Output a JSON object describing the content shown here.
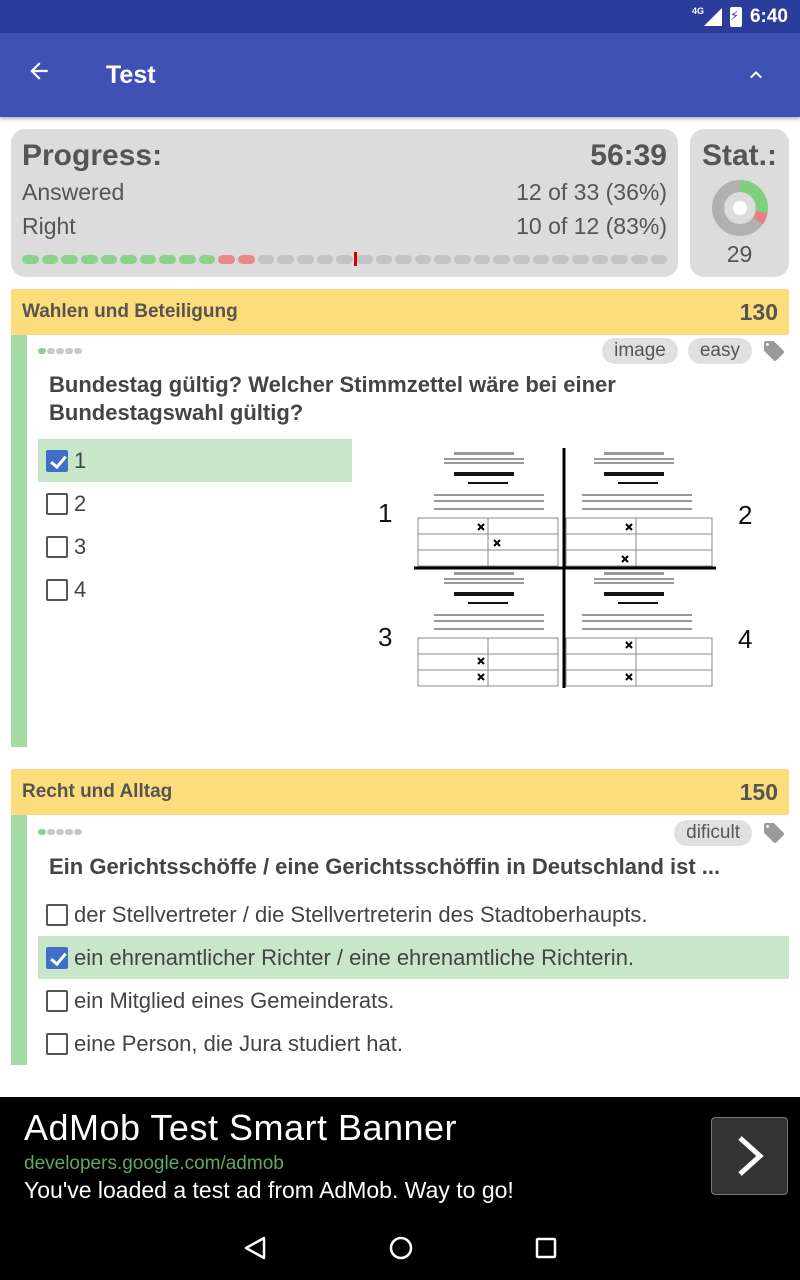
{
  "status_bar": {
    "network": "4G",
    "time": "6:40"
  },
  "app_bar": {
    "title": "Test"
  },
  "progress": {
    "heading": "Progress:",
    "timer": "56:39",
    "answered_label": "Answered",
    "answered_value": "12 of 33 (36%)",
    "right_label": "Right",
    "right_value": "10 of 12 (83%)"
  },
  "stats": {
    "heading": "Stat.:",
    "value": "29"
  },
  "questions": [
    {
      "topic": "Wahlen und Beteiligung",
      "number": "130",
      "tags": [
        "image",
        "easy"
      ],
      "text": "Bundestag gültig? Welcher Stimmzettel wäre bei einer Bundestagswahl gültig?",
      "options": [
        "1",
        "2",
        "3",
        "4"
      ],
      "selected_index": 0,
      "image_labels": [
        "1",
        "2",
        "3",
        "4"
      ]
    },
    {
      "topic": "Recht und Alltag",
      "number": "150",
      "tags": [
        "dificult"
      ],
      "text": "Ein Gerichtsschöffe / eine Gerichtsschöffin in Deutschland ist ...",
      "options": [
        "der Stellvertreter / die Stellvertreterin des Stadtoberhaupts.",
        "ein ehrenamtlicher Richter / eine ehrenamtliche Richterin.",
        "ein Mitglied eines Gemeinderats.",
        "eine Person, die Jura studiert hat."
      ],
      "selected_index": 1
    }
  ],
  "ad": {
    "title": "AdMob Test Smart Banner",
    "url": "developers.google.com/admob",
    "description": "You've loaded a test ad from AdMob. Way to go!"
  },
  "colors": {
    "primary": "#3f51b5",
    "status_bar": "#2c3c9a",
    "topic_header": "#fddc7c",
    "correct_bar": "#a6dba5",
    "selected_option": "#c8e6c9",
    "checkbox_checked": "#3f6fc6"
  },
  "icons": [
    "arrow-back-icon",
    "chevron-up-icon",
    "tag-icon",
    "chevron-right-icon",
    "nav-back-icon",
    "nav-home-icon",
    "nav-recents-icon"
  ]
}
